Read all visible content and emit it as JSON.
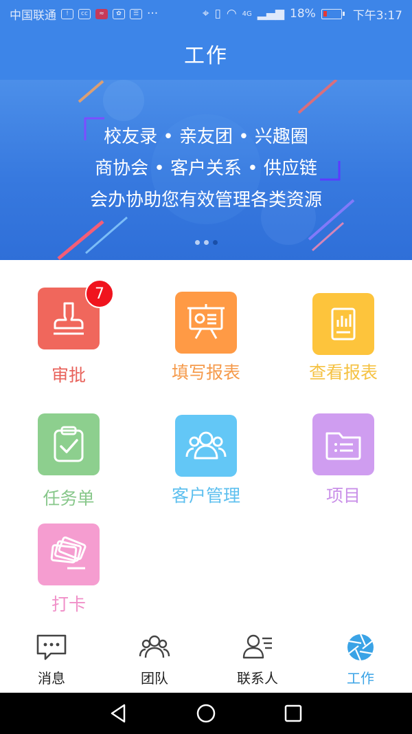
{
  "statusbar": {
    "carrier": "中国联通",
    "cc_label": "cc",
    "more": "···",
    "network": "4G",
    "battery_percent": "18%",
    "time": "下午3:17"
  },
  "header": {
    "title": "工作"
  },
  "banner": {
    "line1": "校友录 • 亲友团 • 兴趣圈",
    "line2": "商协会 • 客户关系 • 供应链",
    "line3": "会办协助您有效管理各类资源",
    "page_count": 3,
    "active_page": 3
  },
  "grid": [
    {
      "label": "审批",
      "color": "#f0675c",
      "label_color": "#e8615a",
      "badge": "7",
      "icon": "stamp-icon"
    },
    {
      "label": "填写报表",
      "color": "#ff9a45",
      "label_color": "#f59a4b",
      "icon": "presentation-icon"
    },
    {
      "label": "查看报表",
      "color": "#fdc43c",
      "label_color": "#f5c243",
      "icon": "report-icon"
    },
    {
      "label": "任务单",
      "color": "#8dcf8e",
      "label_color": "#87c78a",
      "icon": "clipboard-check-icon"
    },
    {
      "label": "客户管理",
      "color": "#63c7f6",
      "label_color": "#5fc0ef",
      "icon": "users-icon"
    },
    {
      "label": "项目",
      "color": "#cf9df0",
      "label_color": "#c98fe8",
      "icon": "folder-icon"
    },
    {
      "label": "打卡",
      "color": "#f59dd0",
      "label_color": "#f08fc8",
      "icon": "cards-icon"
    }
  ],
  "bottomnav": {
    "items": [
      {
        "label": "消息",
        "icon": "message-icon"
      },
      {
        "label": "团队",
        "icon": "team-icon"
      },
      {
        "label": "联系人",
        "icon": "contacts-icon"
      },
      {
        "label": "工作",
        "icon": "aperture-icon"
      }
    ],
    "active_color": "#3aa3e6"
  }
}
